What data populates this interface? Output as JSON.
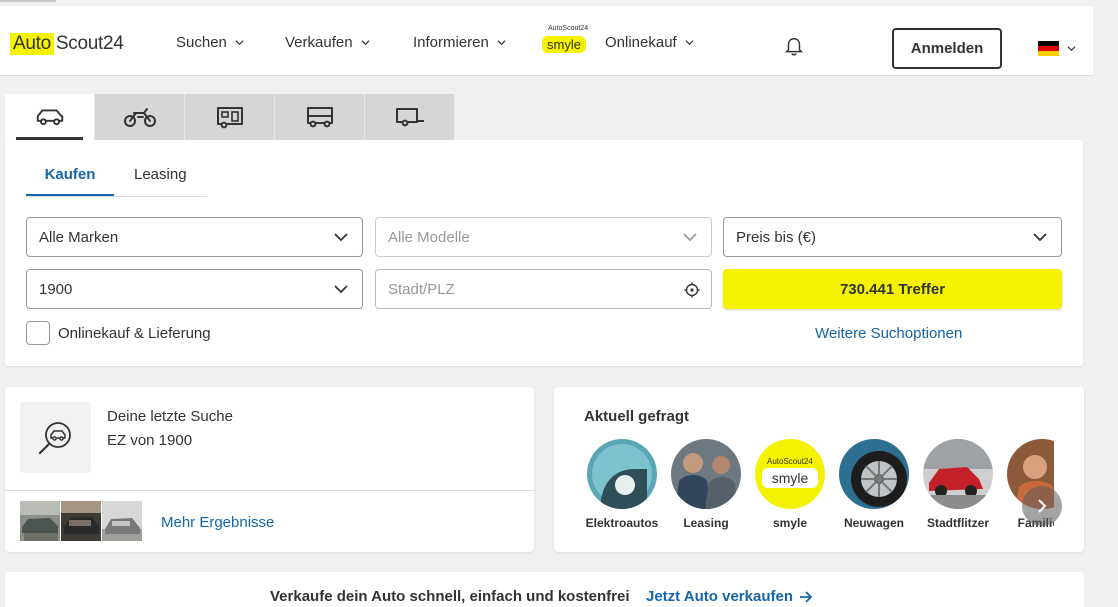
{
  "header": {
    "logo_part1": "Auto",
    "logo_part2": "Scout24",
    "nav": {
      "search": "Suchen",
      "sell": "Verkaufen",
      "inform": "Informieren",
      "smyle_small": "AutoScout24",
      "smyle_word": "smyle",
      "online_buy": "Onlinekauf"
    },
    "login_label": "Anmelden",
    "accent_color": "#f5f200"
  },
  "vehicle_tabs": [
    "car-icon",
    "motorcycle-icon",
    "camper-icon",
    "truck-icon",
    "trailer-icon"
  ],
  "search": {
    "tab_buy": "Kaufen",
    "tab_leasing": "Leasing",
    "make": "Alle Marken",
    "model_placeholder": "Alle Modelle",
    "price": "Preis bis (€)",
    "year": "1900",
    "location_placeholder": "Stadt/PLZ",
    "results_button": "730.441 Treffer",
    "online_checkbox": "Onlinekauf & Lieferung",
    "more_options": "Weitere Suchoptionen"
  },
  "last_search": {
    "title": "Deine letzte Suche",
    "subtitle": "EZ von 1900",
    "more_results": "Mehr Ergebnisse"
  },
  "trending": {
    "title": "Aktuell gefragt",
    "items": [
      {
        "label": "Elektroautos"
      },
      {
        "label": "Leasing"
      },
      {
        "label": "smyle"
      },
      {
        "label": "Neuwagen"
      },
      {
        "label": "Stadtflitzer"
      },
      {
        "label": "Familien"
      }
    ],
    "smyle_small": "AutoScout24",
    "smyle_word": "smyle"
  },
  "sell_bar": {
    "text": "Verkaufe dein Auto schnell, einfach und kostenfrei",
    "link": "Jetzt Auto verkaufen"
  }
}
